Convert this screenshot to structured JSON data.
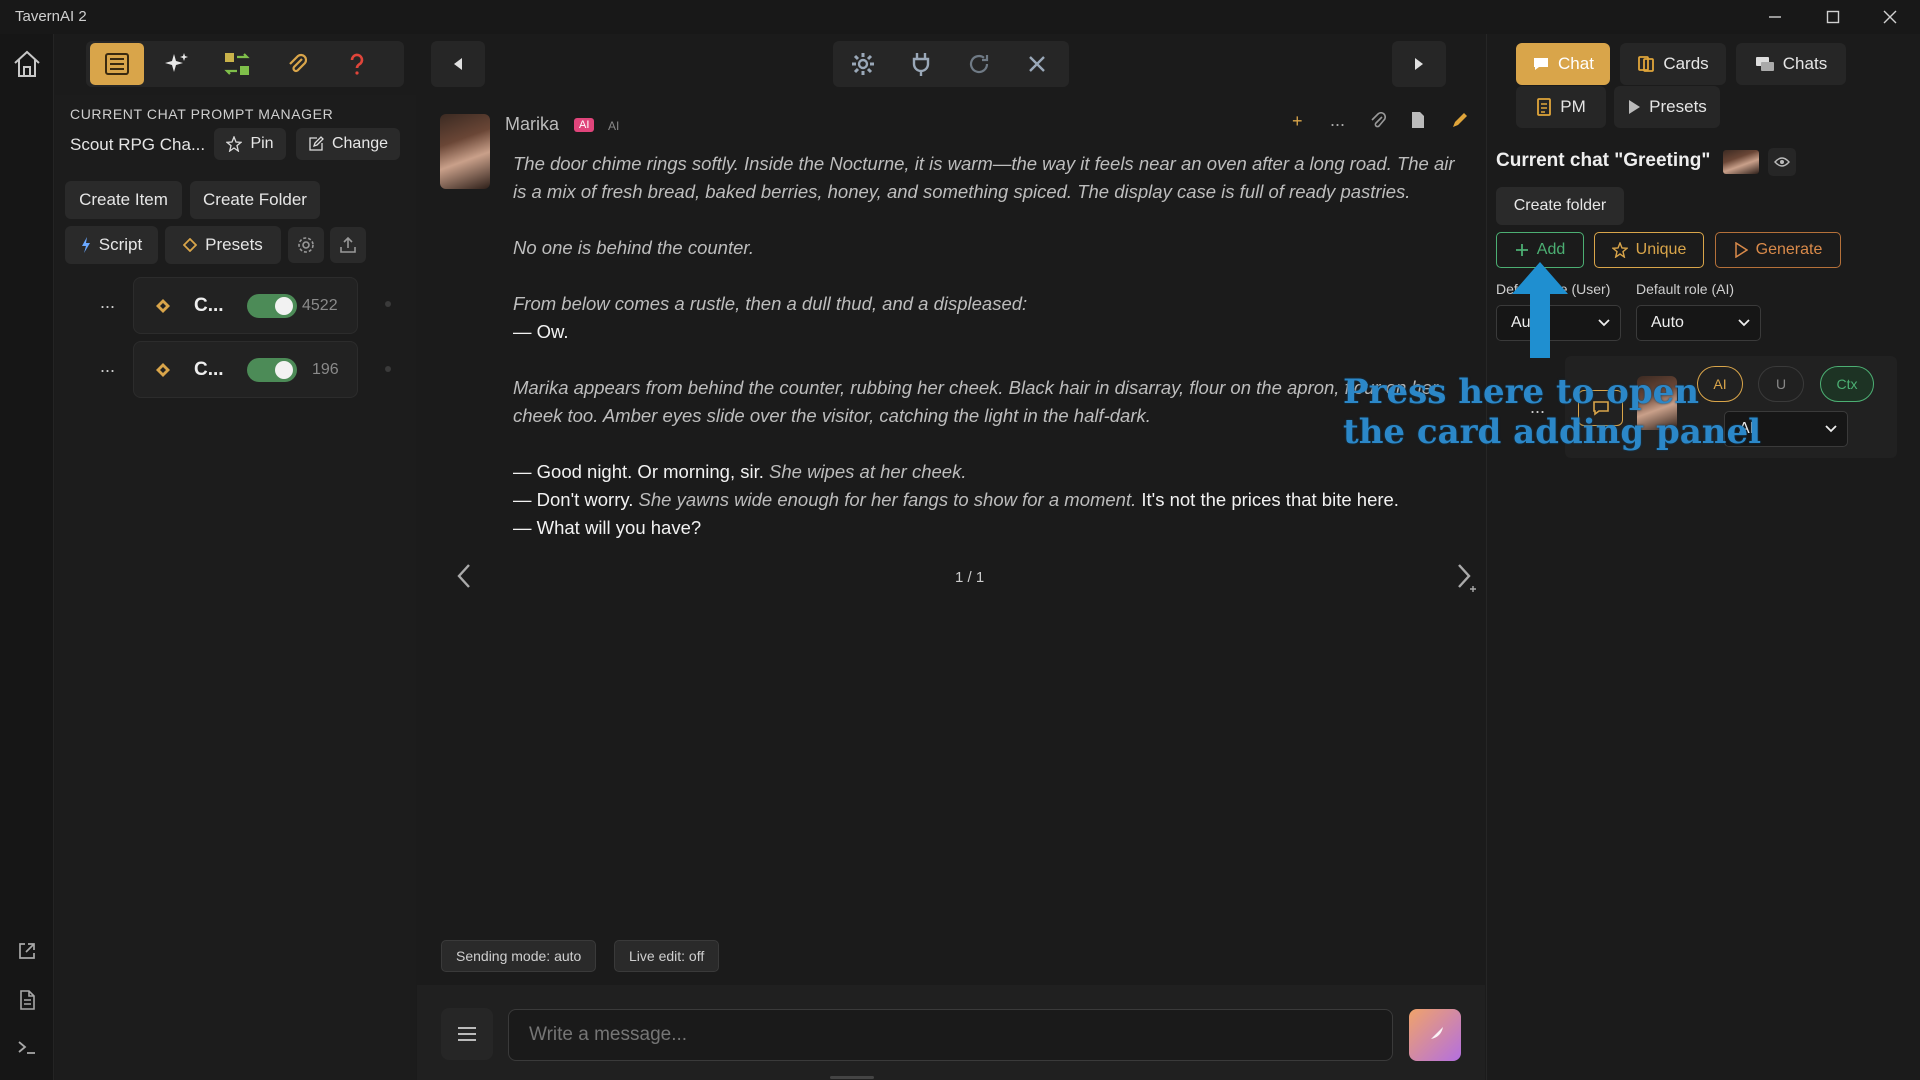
{
  "window": {
    "title": "TavernAI 2"
  },
  "left_toolbar": {
    "icons": [
      "list-icon",
      "sparkles-icon",
      "swap-icon",
      "paperclip-icon",
      "help-icon",
      "collapse-left-icon"
    ]
  },
  "center_toolbar": {
    "icons": [
      "gear-icon",
      "plug-icon",
      "refresh-icon",
      "close-icon",
      "play-icon"
    ]
  },
  "prompt_manager": {
    "header": "CURRENT CHAT PROMPT MANAGER",
    "name": "Scout RPG Cha...",
    "pin_label": "Pin",
    "change_label": "Change",
    "create_item_label": "Create Item",
    "create_folder_label": "Create Folder",
    "script_label": "Script",
    "presets_label": "Presets",
    "items": [
      {
        "title": "C...",
        "enabled": true,
        "tokens": "4522",
        "menu": "..."
      },
      {
        "title": "C...",
        "enabled": true,
        "tokens": "196",
        "menu": "..."
      }
    ]
  },
  "message": {
    "author": "Marika",
    "badge": "AI",
    "role_tag": "AI",
    "actions": {
      "add": "+",
      "more": "..."
    },
    "p1": "The door chime rings softly. Inside the Nocturne, it is warm—the way it feels near an oven after a long road. The air is a mix of fresh bread, baked berries, honey, and something spiced. The display case is full of ready pastries.",
    "p2": "No one is behind the counter.",
    "p3a": "From below comes a rustle, then a dull thud, and a displeased:",
    "p3b": "— Ow.",
    "p4": "Marika appears from behind the counter, rubbing her cheek. Black hair in disarray, flour on the apron, flour on her cheek too. Amber eyes slide over the visitor, catching the light in the half-dark.",
    "l1a": "— Good night. Or morning, sir.",
    "l1b": "She wipes at her cheek.",
    "l2a": "— Don't worry.",
    "l2b": "She yawns wide enough for her fangs to show for a moment.",
    "l2c": "It's not the prices that bite here.",
    "l3": "— What will you have?",
    "pager": "1 / 1"
  },
  "status": {
    "sending_mode": "Sending mode: auto",
    "live_edit": "Live edit: off"
  },
  "composer": {
    "placeholder": "Write a message..."
  },
  "right_panel": {
    "tabs": [
      {
        "label": "Chat",
        "active": true
      },
      {
        "label": "Cards",
        "active": false
      },
      {
        "label": "Chats",
        "active": false
      },
      {
        "label": "PM",
        "active": false
      },
      {
        "label": "Presets",
        "active": false
      }
    ],
    "current_chat_title": "Current chat \"Greeting\"",
    "create_folder_label": "Create folder",
    "add_label": "Add",
    "unique_label": "Unique",
    "generate_label": "Generate",
    "default_role_user_label": "Default role (User)",
    "default_role_user_value": "Auto",
    "default_role_ai_label": "Default role (AI)",
    "default_role_ai_value": "Auto",
    "card_more": "...",
    "role_ai": "AI",
    "role_u": "U",
    "role_ctx": "Ctx",
    "card_role_value": "AI"
  },
  "annotation": {
    "line1": "Press here to open",
    "line2": "the card adding panel",
    "color": "#2b87c8"
  },
  "colors": {
    "accent": "#d9a54a",
    "add_green": "#4caf73",
    "unique_gold": "#d9a54a",
    "generate_orange": "#d98a4a",
    "annotation_blue": "#2b87c8"
  }
}
